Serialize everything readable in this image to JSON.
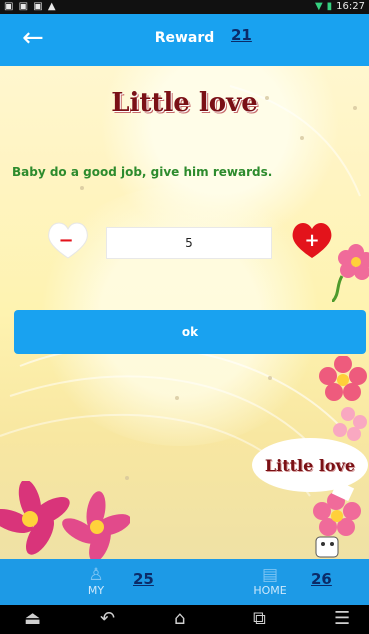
{
  "status_bar": {
    "left_icons": "▣ ▣ ▣ ▲",
    "wifi_icon": "▼",
    "battery_icon": "▮",
    "time": "16:27"
  },
  "app_bar": {
    "back_icon": "←",
    "title": "Reward",
    "badge": "21"
  },
  "main": {
    "heading": "Little love",
    "subtitle": "Baby do a good job, give him rewards.",
    "decrement_symbol": "−",
    "increment_symbol": "+",
    "quantity": "5",
    "ok_label": "ok",
    "bubble_text": "Little love"
  },
  "bottom_nav": {
    "tabs": [
      {
        "label": "MY",
        "icon": "person-icon",
        "glyph": "♙"
      },
      {
        "label": "HOME",
        "icon": "home-icon",
        "glyph": "▤"
      }
    ],
    "number_left": "25",
    "number_right": "26"
  },
  "system_nav": {
    "glyphs": [
      "⏏",
      "↶",
      "⌂",
      "⧉",
      "☰"
    ]
  },
  "colors": {
    "accent": "#19a2f0",
    "heading": "#7a1015",
    "subtitle": "#2d8b2d",
    "heart_red": "#e3131b"
  }
}
